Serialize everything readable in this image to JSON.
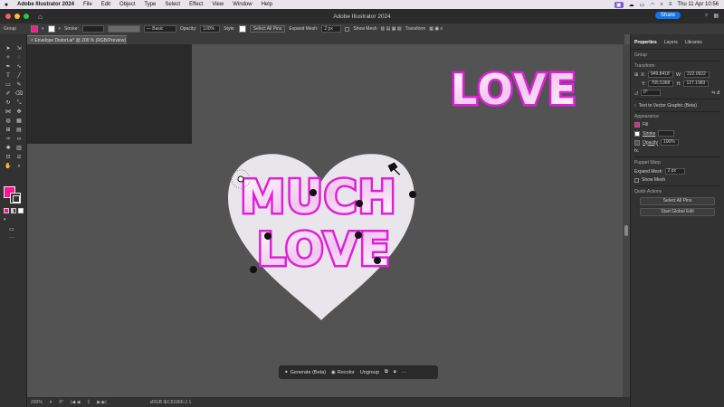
{
  "menubar": {
    "apple": "",
    "app_name": "Adobe Illustrator 2024",
    "menus": [
      "File",
      "Edit",
      "Object",
      "Type",
      "Select",
      "Effect",
      "View",
      "Window",
      "Help"
    ],
    "datetime": "Thu 11 Apr  10:56"
  },
  "titlebar": {
    "title": "Adobe Illustrator 2024",
    "share_label": "Share"
  },
  "controlbar": {
    "selection_label": "Group",
    "stroke_label": "Stroke:",
    "brush_label": "Basic",
    "opacity_label": "Opacity:",
    "opacity_value": "100%",
    "style_label": "Style:",
    "select_all_pins": "Select All Pins",
    "expand_mesh_label": "Expand Mesh:",
    "expand_mesh_value": "2 px",
    "show_mesh_label": "Show Mesh",
    "transform_label": "Transform",
    "colors": {
      "fill": "#ff1493",
      "accent": "#1473e6"
    }
  },
  "doctab": {
    "label": "Envelope Distort.ai* @ 200 % (RGB/Preview)"
  },
  "artwork": {
    "top_word": "LOVE",
    "heart_line1": "MUCH",
    "heart_line2": "LOVE",
    "colors": {
      "magenta": "#e020d8",
      "heart": "#e8e6ea",
      "pins": "#111111"
    }
  },
  "taskbar": {
    "generate": "Generate (Beta)",
    "recolor": "Recolor",
    "ungroup": "Ungroup",
    "more": "···"
  },
  "statusbar": {
    "zoom": "200%",
    "rotation": "0°",
    "artboard": "1",
    "profile": "sRGB IEC61966-2.1"
  },
  "panel": {
    "tabs": [
      "Properties",
      "Layers",
      "Libraries"
    ],
    "group_label": "Group",
    "transform_title": "Transform",
    "x_label": "X:",
    "x_value": "949.8418",
    "y_label": "Y:",
    "y_value": "705.5368",
    "w_label": "W:",
    "w_value": "222.0922",
    "h_label": "H:",
    "h_value": "127.1983",
    "rotate_value": "0°",
    "text_to_vector": "Text to Vector Graphic (Beta)",
    "appearance_title": "Appearance",
    "fill_label": "Fill",
    "stroke_label": "Stroke",
    "opacity_label": "Opacity",
    "opacity_value": "100%",
    "fx_label": "fx.",
    "puppet_warp_title": "Puppet Warp",
    "expand_mesh_label": "Expand Mesh",
    "expand_mesh_value": "2 px",
    "show_mesh_label": "Show Mesh",
    "quick_actions_title": "Quick Actions",
    "select_all_pins": "Select All Pins",
    "start_global_edit": "Start Global Edit"
  }
}
